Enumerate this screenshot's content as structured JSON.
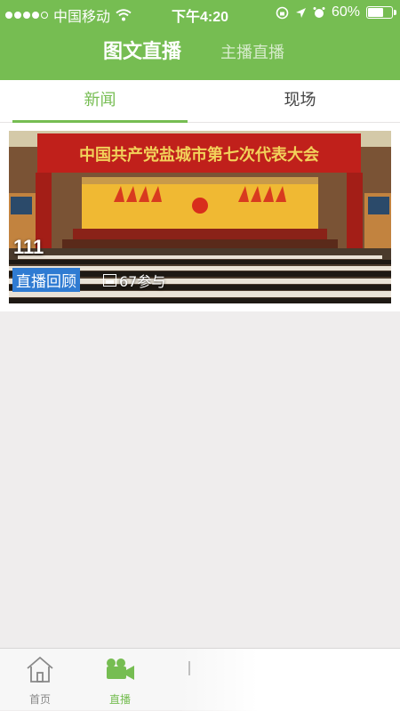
{
  "status_bar": {
    "carrier": "中国移动",
    "time": "下午4:20",
    "battery": "60%",
    "battery_level": 0.6
  },
  "nav": {
    "tabs": [
      {
        "label": "图文直播",
        "active": true
      },
      {
        "label": "主播直播",
        "active": false
      }
    ]
  },
  "sub_tabs": [
    {
      "label": "新闻",
      "active": true
    },
    {
      "label": "现场",
      "active": false
    }
  ],
  "feed": [
    {
      "title": "111",
      "badge": "直播回顾",
      "participants": "67参与",
      "banner_text": "中国共产党盐城市第七次代表大会"
    }
  ],
  "tab_bar": {
    "items": [
      {
        "label": "首页",
        "icon": "home-icon",
        "active": false
      },
      {
        "label": "直播",
        "icon": "video-camera-icon",
        "active": true
      },
      {
        "label": "",
        "icon": "partial-icon",
        "active": false
      }
    ]
  },
  "colors": {
    "primary": "#76bd52",
    "badge": "#2f7bd2",
    "background": "#efeded"
  }
}
